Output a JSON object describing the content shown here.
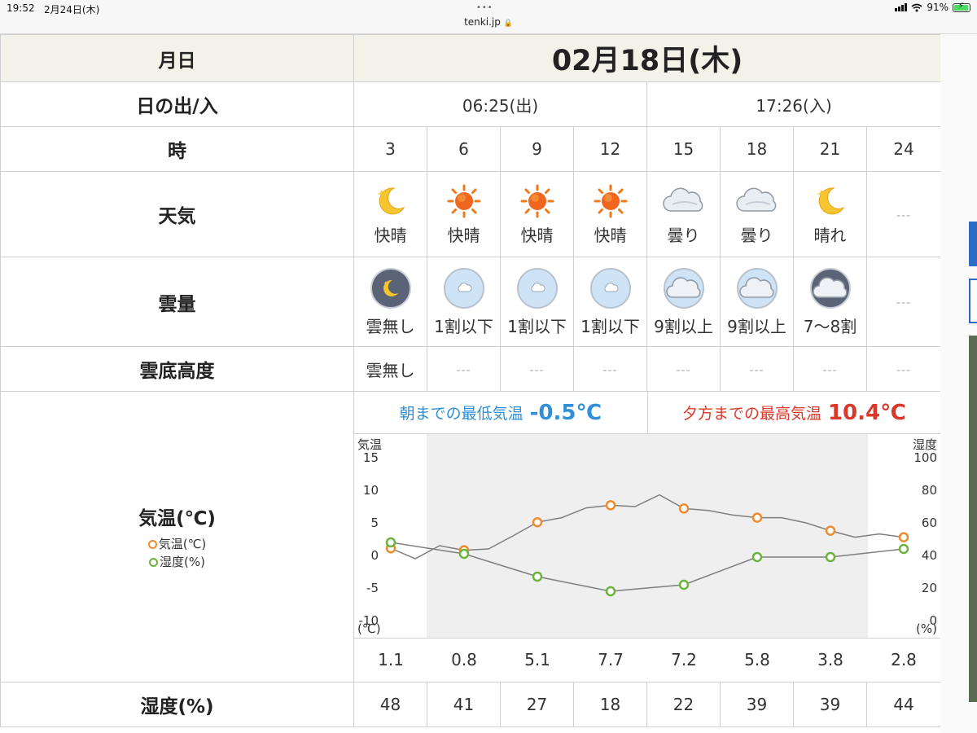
{
  "status_bar": {
    "time": "19:52",
    "date": "2月24日(木)",
    "dots": "•••",
    "url": "tenki.jp",
    "battery": "91%"
  },
  "rows": {
    "date_label": "月日",
    "date_value": "02月18日(木)",
    "sun_label": "日の出/入",
    "sunrise": "06:25(出)",
    "sunset": "17:26(入)",
    "hour_label": "時",
    "weather_label": "天気",
    "cloud_label": "雲量",
    "ceiling_label": "雲底高度",
    "temp_label": "気温(℃)",
    "legend_temp": "気温(℃)",
    "legend_humidity": "湿度(%)",
    "humidity_label": "湿度(%)"
  },
  "dash": "---",
  "hours": [
    "3",
    "6",
    "9",
    "12",
    "15",
    "18",
    "21",
    "24"
  ],
  "weather": [
    {
      "icon": "moon-clear-icon",
      "label": "快晴"
    },
    {
      "icon": "sun-icon",
      "label": "快晴"
    },
    {
      "icon": "sun-icon",
      "label": "快晴"
    },
    {
      "icon": "sun-icon",
      "label": "快晴"
    },
    {
      "icon": "cloud-icon",
      "label": "曇り"
    },
    {
      "icon": "cloud-icon",
      "label": "曇り"
    },
    {
      "icon": "moon-clear-icon",
      "label": "晴れ"
    },
    {
      "icon": "none",
      "label": "---"
    }
  ],
  "cloud_amount": [
    {
      "icon": "cloudless-night-icon",
      "label": "雲無し"
    },
    {
      "icon": "small-cloud-icon",
      "label": "1割以下"
    },
    {
      "icon": "small-cloud-icon",
      "label": "1割以下"
    },
    {
      "icon": "small-cloud-icon",
      "label": "1割以下"
    },
    {
      "icon": "overcast-day-icon",
      "label": "9割以上"
    },
    {
      "icon": "overcast-day-icon",
      "label": "9割以上"
    },
    {
      "icon": "overcast-night-icon",
      "label": "7〜8割"
    },
    {
      "icon": "none",
      "label": "---"
    }
  ],
  "cloud_ceiling": [
    "雲無し",
    "---",
    "---",
    "---",
    "---",
    "---",
    "---",
    "---"
  ],
  "temp_summary": {
    "low_text": "朝までの最低気温",
    "low_value": "-0.5℃",
    "high_text": "夕方までの最高気温",
    "high_value": "10.4℃"
  },
  "temperatures": [
    "1.1",
    "0.8",
    "5.1",
    "7.7",
    "7.2",
    "5.8",
    "3.8",
    "2.8"
  ],
  "humidity": [
    "48",
    "41",
    "27",
    "18",
    "22",
    "39",
    "39",
    "44"
  ],
  "colors": {
    "temp_line": "#ef8a2e",
    "humidity_line": "#6ab33c",
    "low_text": "#2f8fd8",
    "high_text": "#d9392b"
  },
  "chart_data": {
    "type": "line",
    "x": [
      3,
      6,
      9,
      12,
      15,
      18,
      21,
      24
    ],
    "left_axis": {
      "label": "気温",
      "unit_label": "(℃)",
      "ticks": [
        "15",
        "10",
        "5",
        "0",
        "-5",
        "-10"
      ],
      "ylim": [
        -10,
        15
      ]
    },
    "right_axis": {
      "label": "湿度",
      "unit_label": "(%)",
      "ticks": [
        "100",
        "80",
        "60",
        "40",
        "20",
        "0"
      ],
      "ylim": [
        0,
        100
      ]
    },
    "series": [
      {
        "name": "気温(℃)",
        "axis": "left",
        "values": [
          1.1,
          0.8,
          5.1,
          7.7,
          7.2,
          5.8,
          3.8,
          2.8
        ]
      },
      {
        "name": "湿度(%)",
        "axis": "right",
        "values": [
          48,
          41,
          27,
          18,
          22,
          39,
          39,
          44
        ]
      }
    ],
    "hourly_temperature_line": {
      "x": [
        3,
        4,
        5,
        6,
        7,
        8,
        9,
        10,
        11,
        12,
        13,
        14,
        15,
        16,
        17,
        18,
        19,
        20,
        21,
        22,
        23,
        24
      ],
      "values": [
        1.1,
        -0.5,
        1.5,
        0.8,
        1.0,
        3.0,
        5.1,
        5.8,
        7.3,
        7.7,
        7.5,
        9.3,
        7.2,
        6.9,
        6.2,
        5.8,
        5.8,
        5.0,
        3.8,
        2.8,
        3.3,
        2.8
      ]
    },
    "grid": true
  }
}
